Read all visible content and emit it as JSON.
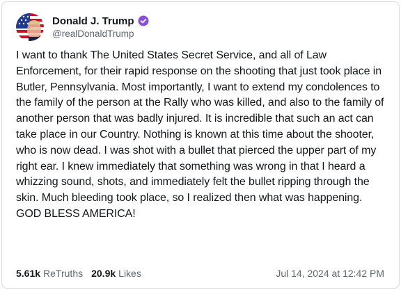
{
  "post": {
    "author": {
      "display_name": "Donald J. Trump",
      "handle": "@realDonaldTrump",
      "avatar_icon": "avatar-american-flag",
      "verified_icon": "verified-badge-icon",
      "verified_color": "#8a4fd8"
    },
    "text": "I want to thank The United States Secret Service, and all of Law Enforcement, for their rapid response on the shooting that just took place in Butler, Pennsylvania. Most importantly, I want to extend my condolences to the family of the person at the Rally who was killed, and also to the family of another person that was badly injured. It is incredible that such an act can take place in our Country. Nothing is known at this time about the shooter, who is now dead. I was shot with a bullet that pierced the upper part of my right ear. I knew immediately that something was wrong in that I heard a whizzing sound, shots, and immediately felt the bullet ripping through the skin. Much bleeding took place, so I realized then what was happening. GOD BLESS AMERICA!",
    "stats": {
      "retruths_count": "5.61k",
      "retruths_label": "ReTruths",
      "likes_count": "20.9k",
      "likes_label": "Likes"
    },
    "timestamp": "Jul 14, 2024 at 12:42 PM"
  },
  "colors": {
    "text_primary": "#14171a",
    "text_secondary": "#5e6670",
    "border": "#d7d9dc",
    "background": "#ffffff"
  }
}
